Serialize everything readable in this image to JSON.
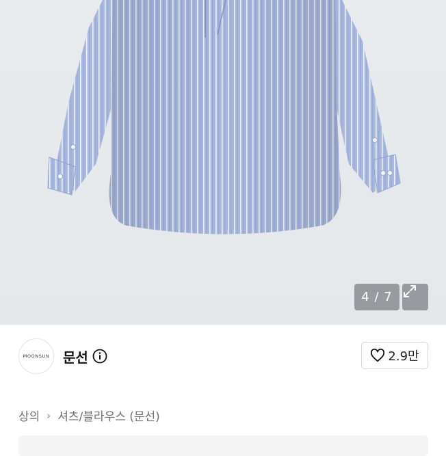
{
  "gallery": {
    "counter": "4 / 7",
    "image_alt": "striped-shirt-photo"
  },
  "seller": {
    "logo_text": "MOONSUN",
    "name": "문선",
    "likes": "2.9만"
  },
  "breadcrumb": {
    "items": [
      "상의",
      "셔츠/블라우스 (문선)"
    ],
    "separator": "›"
  },
  "colors": {
    "shirt": "#aab9e0",
    "stripe": "#f2f4fa",
    "background": "#e6e9ec"
  }
}
